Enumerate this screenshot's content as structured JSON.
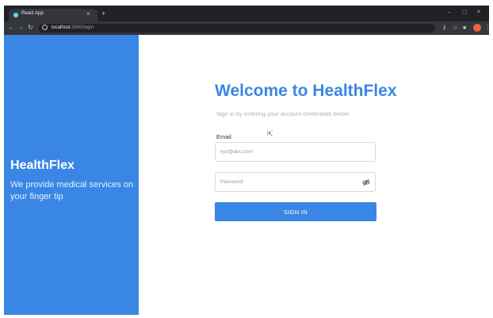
{
  "browser": {
    "tab_title": "React App",
    "close_tab": "×",
    "new_tab": "+",
    "url_host": "localhost",
    "url_path": ":3000/login",
    "window_controls": [
      "–",
      "▢",
      "✕"
    ]
  },
  "sidebar": {
    "brand": "HealthFlex",
    "tagline": "We provide medical services on your finger tip",
    "background_color": "#3a86e4"
  },
  "login": {
    "heading": "Welcome to HealthFlex",
    "subtitle": "Sign in by entering your account credentials below",
    "email_label": "Email",
    "email_placeholder": "xyz@abc.com",
    "password_placeholder": "Password",
    "signin_label": "SIGN IN",
    "accent_color": "#3a86e4"
  },
  "icons": [
    "back-icon",
    "forward-icon",
    "reload-icon",
    "info-icon",
    "key-icon",
    "star-icon",
    "extension-icon",
    "profile-avatar-icon",
    "menu-icon",
    "eye-slash-icon",
    "mouse-cursor-icon"
  ]
}
